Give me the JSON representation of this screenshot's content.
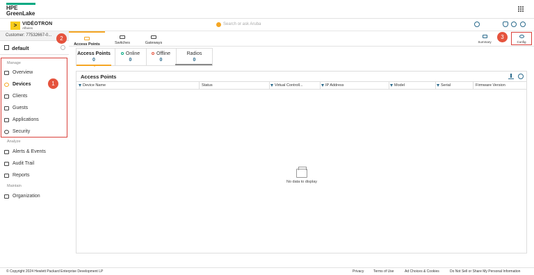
{
  "header": {
    "logo_top": "HPE",
    "logo_bottom": "GreenLake"
  },
  "brand": {
    "mark": ">",
    "name": "VIDÉOTRON",
    "sub": "Affaires"
  },
  "search": {
    "placeholder": "Search or ask Aruba"
  },
  "sidebar": {
    "customer": "Customer: 77532667-0...",
    "group": "default",
    "sections": {
      "manage": "Manage",
      "analyze": "Analyze",
      "maintain": "Maintain"
    },
    "manage_items": [
      {
        "label": "Overview",
        "icon": "overview-icon"
      },
      {
        "label": "Devices",
        "icon": "devices-icon",
        "active": true
      },
      {
        "label": "Clients",
        "icon": "clients-icon"
      },
      {
        "label": "Guests",
        "icon": "guests-icon"
      },
      {
        "label": "Applications",
        "icon": "applications-icon"
      },
      {
        "label": "Security",
        "icon": "security-icon"
      }
    ],
    "analyze_items": [
      {
        "label": "Alerts & Events",
        "icon": "alerts-icon"
      },
      {
        "label": "Audit Trail",
        "icon": "audit-trail-icon"
      },
      {
        "label": "Reports",
        "icon": "reports-icon"
      }
    ],
    "maintain_items": [
      {
        "label": "Organization",
        "icon": "organization-icon"
      }
    ]
  },
  "main_tabs": [
    {
      "label": "Access Points",
      "icon": "access-point-icon",
      "active": true
    },
    {
      "label": "Switches",
      "icon": "switch-icon"
    },
    {
      "label": "Gateways",
      "icon": "gateway-icon"
    }
  ],
  "right_tabs": [
    {
      "label": "Summary",
      "icon": "summary-icon"
    },
    {
      "label": "Config",
      "icon": "gear-icon",
      "active": true
    }
  ],
  "cards": [
    {
      "label": "Access Points",
      "value": "0",
      "active": true
    },
    {
      "label": "Online",
      "value": "0",
      "dot_color": "#01a982"
    },
    {
      "label": "Offline",
      "value": "0",
      "dot_color": "#e5533d"
    },
    {
      "label": "Radios",
      "value": "0"
    }
  ],
  "table": {
    "title": "Access Points",
    "columns": [
      "Device Name",
      "Status",
      "Virtual Controll...",
      "IP Address",
      "Model",
      "Serial",
      "Firmware Version"
    ],
    "empty_text": "No data to display"
  },
  "badges": [
    "1",
    "2",
    "3"
  ],
  "colors": {
    "accent": "#f5a623",
    "hpe_green": "#01a982",
    "annotation_red": "#e5533d",
    "link_blue": "#2a6a8c"
  },
  "footer": {
    "copyright": "© Copyright 2024 Hewlett Packard Enterprise Development LP",
    "links": [
      "Privacy",
      "Terms of Use",
      "Ad Choices & Cookies",
      "Do Not Sell or Share My Personal Information"
    ]
  }
}
